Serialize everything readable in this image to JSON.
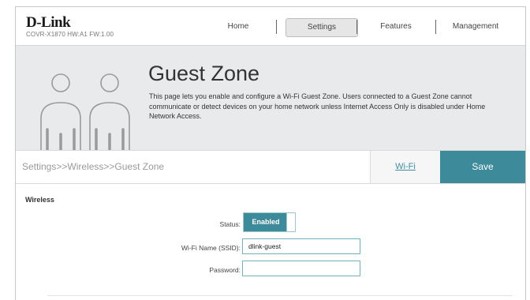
{
  "header": {
    "brand": "D-Link",
    "model": "COVR-X1870 HW:A1 FW:1.00",
    "nav": [
      {
        "label": "Home"
      },
      {
        "label": "Settings",
        "active": true
      },
      {
        "label": "Features"
      },
      {
        "label": "Management"
      }
    ]
  },
  "banner": {
    "title": "Guest Zone",
    "description": "This page lets you enable and configure a Wi-Fi Guest Zone. Users connected to a Guest Zone cannot communicate or detect devices on your home network unless Internet Access Only is disabled under Home Network Access.",
    "icon": "two-people-icon"
  },
  "toolbar": {
    "breadcrumb": "Settings>>Wireless>>Guest Zone",
    "wifi_link": "Wi-Fi",
    "save_label": "Save"
  },
  "wireless": {
    "section_title": "Wireless",
    "status_label": "Status:",
    "status_value": "Enabled",
    "ssid_label": "Wi-Fi Name (SSID):",
    "ssid_value": "dlink-guest",
    "password_label": "Password:",
    "password_value": ""
  },
  "colors": {
    "accent": "#3d8a9a",
    "banner_bg": "#e9eaeb",
    "link": "#3a8fa0"
  }
}
